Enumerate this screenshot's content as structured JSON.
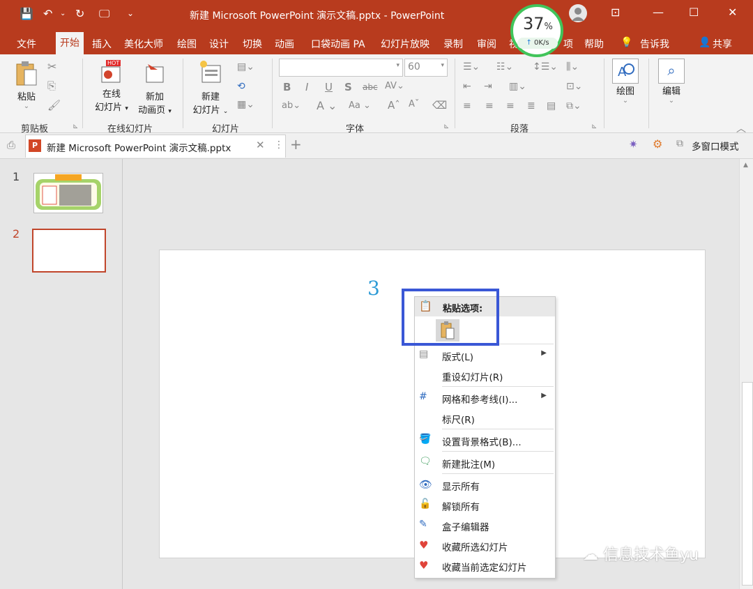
{
  "window": {
    "title": "新建 Microsoft PowerPoint 演示文稿.pptx  -  PowerPoint",
    "perf_percent": "37",
    "perf_unit": "%",
    "net_speed": "0K/s"
  },
  "tabs": [
    "文件",
    "开始",
    "插入",
    "美化大师",
    "绘图",
    "设计",
    "切换",
    "动画",
    "口袋动画 PA",
    "幻灯片放映",
    "录制",
    "审阅",
    "视",
    "项",
    "帮助",
    "告诉我",
    "共享"
  ],
  "ribbon": {
    "paste": "粘贴",
    "online_slide_1": "在线",
    "online_slide_2": "幻灯片",
    "new_anim_1": "新加",
    "new_anim_2": "动画页",
    "hot": "HOT",
    "new_slide_1": "新建",
    "new_slide_2": "幻灯片",
    "font_size": "60",
    "draw": "绘图",
    "edit": "编辑",
    "groups": {
      "clipboard": "剪贴板",
      "online": "在线幻灯片",
      "slides": "幻灯片",
      "font": "字体",
      "paragraph": "段落"
    }
  },
  "doc_tab": {
    "name": "新建 Microsoft PowerPoint 演示文稿.pptx",
    "multiwin": "多窗口模式"
  },
  "thumbs": [
    {
      "num": "1"
    },
    {
      "num": "2"
    }
  ],
  "slide": {
    "placeholder_num": "3"
  },
  "context_menu": {
    "header": "粘贴选项:",
    "items": [
      {
        "label": "版式(L)",
        "submenu": true
      },
      {
        "label": "重设幻灯片(R)"
      },
      {
        "label": "网格和参考线(I)...",
        "submenu": true
      },
      {
        "label": "标尺(R)"
      },
      {
        "label": "设置背景格式(B)..."
      },
      {
        "label": "新建批注(M)"
      },
      {
        "label": "显示所有"
      },
      {
        "label": "解锁所有"
      },
      {
        "label": "盒子编辑器"
      },
      {
        "label": "收藏所选幻灯片"
      },
      {
        "label": "收藏当前选定幻灯片"
      }
    ]
  },
  "watermark": "信息技术鱼yu",
  "colors": {
    "accent": "#b83b1e",
    "highlight": "#3a57d6"
  }
}
